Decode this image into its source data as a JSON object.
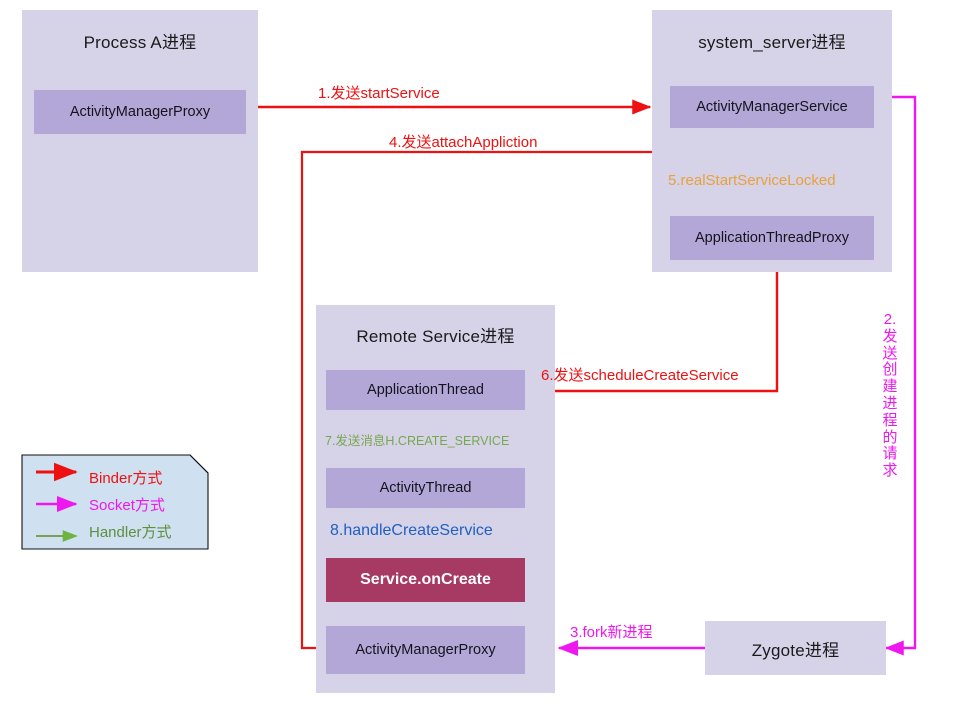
{
  "title": "Android startService cross-process flow diagram",
  "colors": {
    "process_fill": "#d6d2e8",
    "component_fill": "#b2a7d6",
    "accent_fill": "#a63a63",
    "binder_red": "#ee1111",
    "socket_magenta": "#ee18ee",
    "handler_green": "#77a84e",
    "orange": "#e8a13c",
    "blue": "#2060c0",
    "legend_fill": "#cfe0f0"
  },
  "processes": {
    "process_a": {
      "title": "Process A进程",
      "components": [
        {
          "label": "ActivityManagerProxy"
        }
      ]
    },
    "system_server": {
      "title": "system_server进程",
      "components": [
        {
          "label": "ActivityManagerService"
        },
        {
          "label": "ApplicationThreadProxy"
        }
      ]
    },
    "remote_service": {
      "title": "Remote Service进程",
      "components": [
        {
          "label": "ApplicationThread"
        },
        {
          "label": "ActivityThread"
        },
        {
          "label": "Service.onCreate"
        },
        {
          "label": "ActivityManagerProxy"
        }
      ]
    },
    "zygote": {
      "title": "Zygote进程"
    }
  },
  "edges": [
    {
      "id": "step1",
      "label": "1.发送startService",
      "kind": "binder"
    },
    {
      "id": "step2",
      "label": "2.发送创建进程的请求",
      "kind": "socket"
    },
    {
      "id": "step3",
      "label": "3.fork新进程",
      "kind": "socket"
    },
    {
      "id": "step4",
      "label": "4.发送attachAppliction",
      "kind": "binder"
    },
    {
      "id": "step5",
      "label": "5.realStartServiceLocked",
      "kind": "call"
    },
    {
      "id": "step6",
      "label": "6.发送scheduleCreateService",
      "kind": "binder"
    },
    {
      "id": "step7",
      "label": "7.发送消息H.CREATE_SERVICE",
      "kind": "handler"
    },
    {
      "id": "step8",
      "label": "8.handleCreateService",
      "kind": "call"
    }
  ],
  "legend": {
    "items": [
      {
        "label": "Binder方式",
        "color": "#ee1111"
      },
      {
        "label": "Socket方式",
        "color": "#ee18ee"
      },
      {
        "label": "Handler方式",
        "color": "#6b9a45"
      }
    ]
  }
}
